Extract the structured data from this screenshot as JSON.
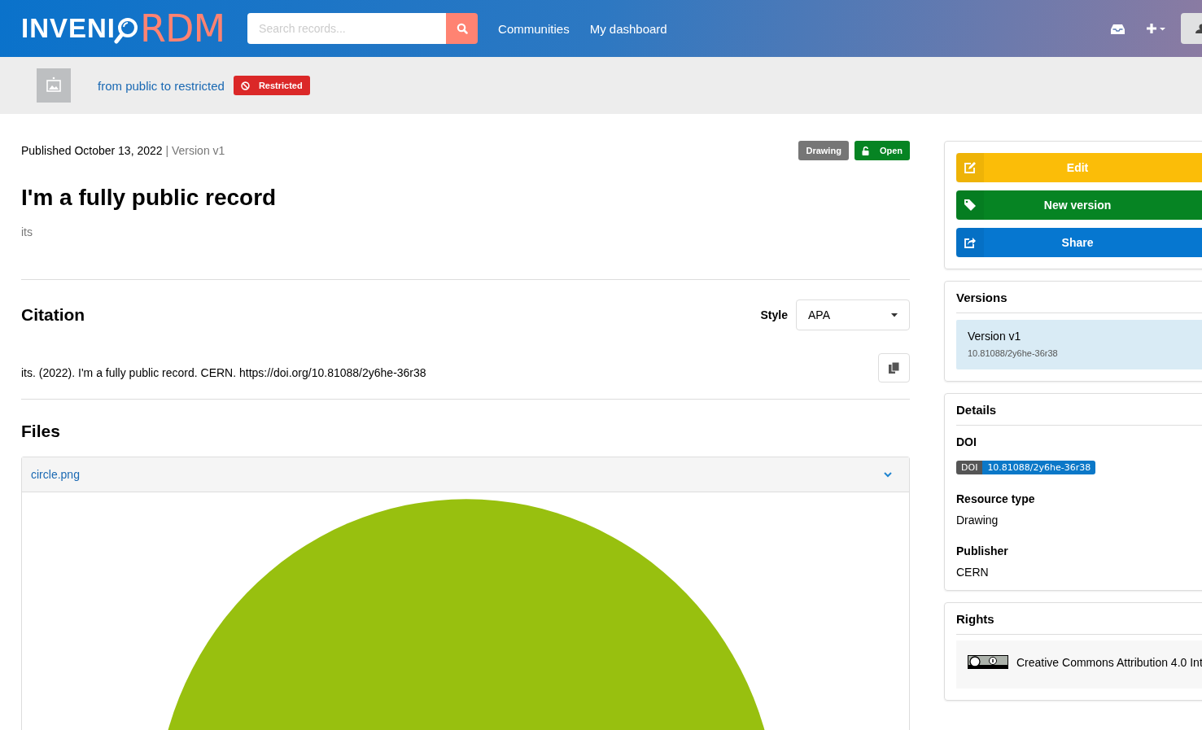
{
  "header": {
    "logo": {
      "text": "INVENI",
      "accent": "RDM"
    },
    "search": {
      "placeholder": "Search records..."
    },
    "nav": [
      "Communities",
      "My dashboard"
    ]
  },
  "community": {
    "name": "from public to restricted",
    "badge": "Restricted"
  },
  "record": {
    "published": "Published October 13, 2022",
    "separator": "|",
    "version": "Version v1",
    "badges": [
      {
        "label": "Drawing",
        "kind": "type"
      },
      {
        "label": "Open",
        "kind": "access"
      }
    ],
    "title": "I'm a fully public record",
    "creators": "its"
  },
  "citation": {
    "heading": "Citation",
    "style_label": "Style",
    "style": "APA",
    "text": "its. (2022). I'm a fully public record. CERN. https://doi.org/10.81088/2y6he-36r38"
  },
  "files": {
    "heading": "Files",
    "items": [
      {
        "name": "circle.png",
        "expanded": true
      }
    ]
  },
  "actions": [
    {
      "label": "Edit",
      "kind": "edit"
    },
    {
      "label": "New version",
      "kind": "new-version"
    },
    {
      "label": "Share",
      "kind": "share"
    }
  ],
  "versions": {
    "heading": "Versions",
    "items": [
      {
        "label": "Version v1",
        "doi": "10.81088/2y6he-36r38",
        "selected": true
      }
    ]
  },
  "details": {
    "heading": "Details",
    "doi_label": "DOI",
    "doi": {
      "prefix": "DOI",
      "value": "10.81088/2y6he-36r38"
    },
    "fields": [
      {
        "label": "Resource type",
        "value": "Drawing"
      },
      {
        "label": "Publisher",
        "value": "CERN"
      }
    ]
  },
  "rights": {
    "heading": "Rights",
    "license": "Creative Commons Attribution 4.0 Int"
  }
}
